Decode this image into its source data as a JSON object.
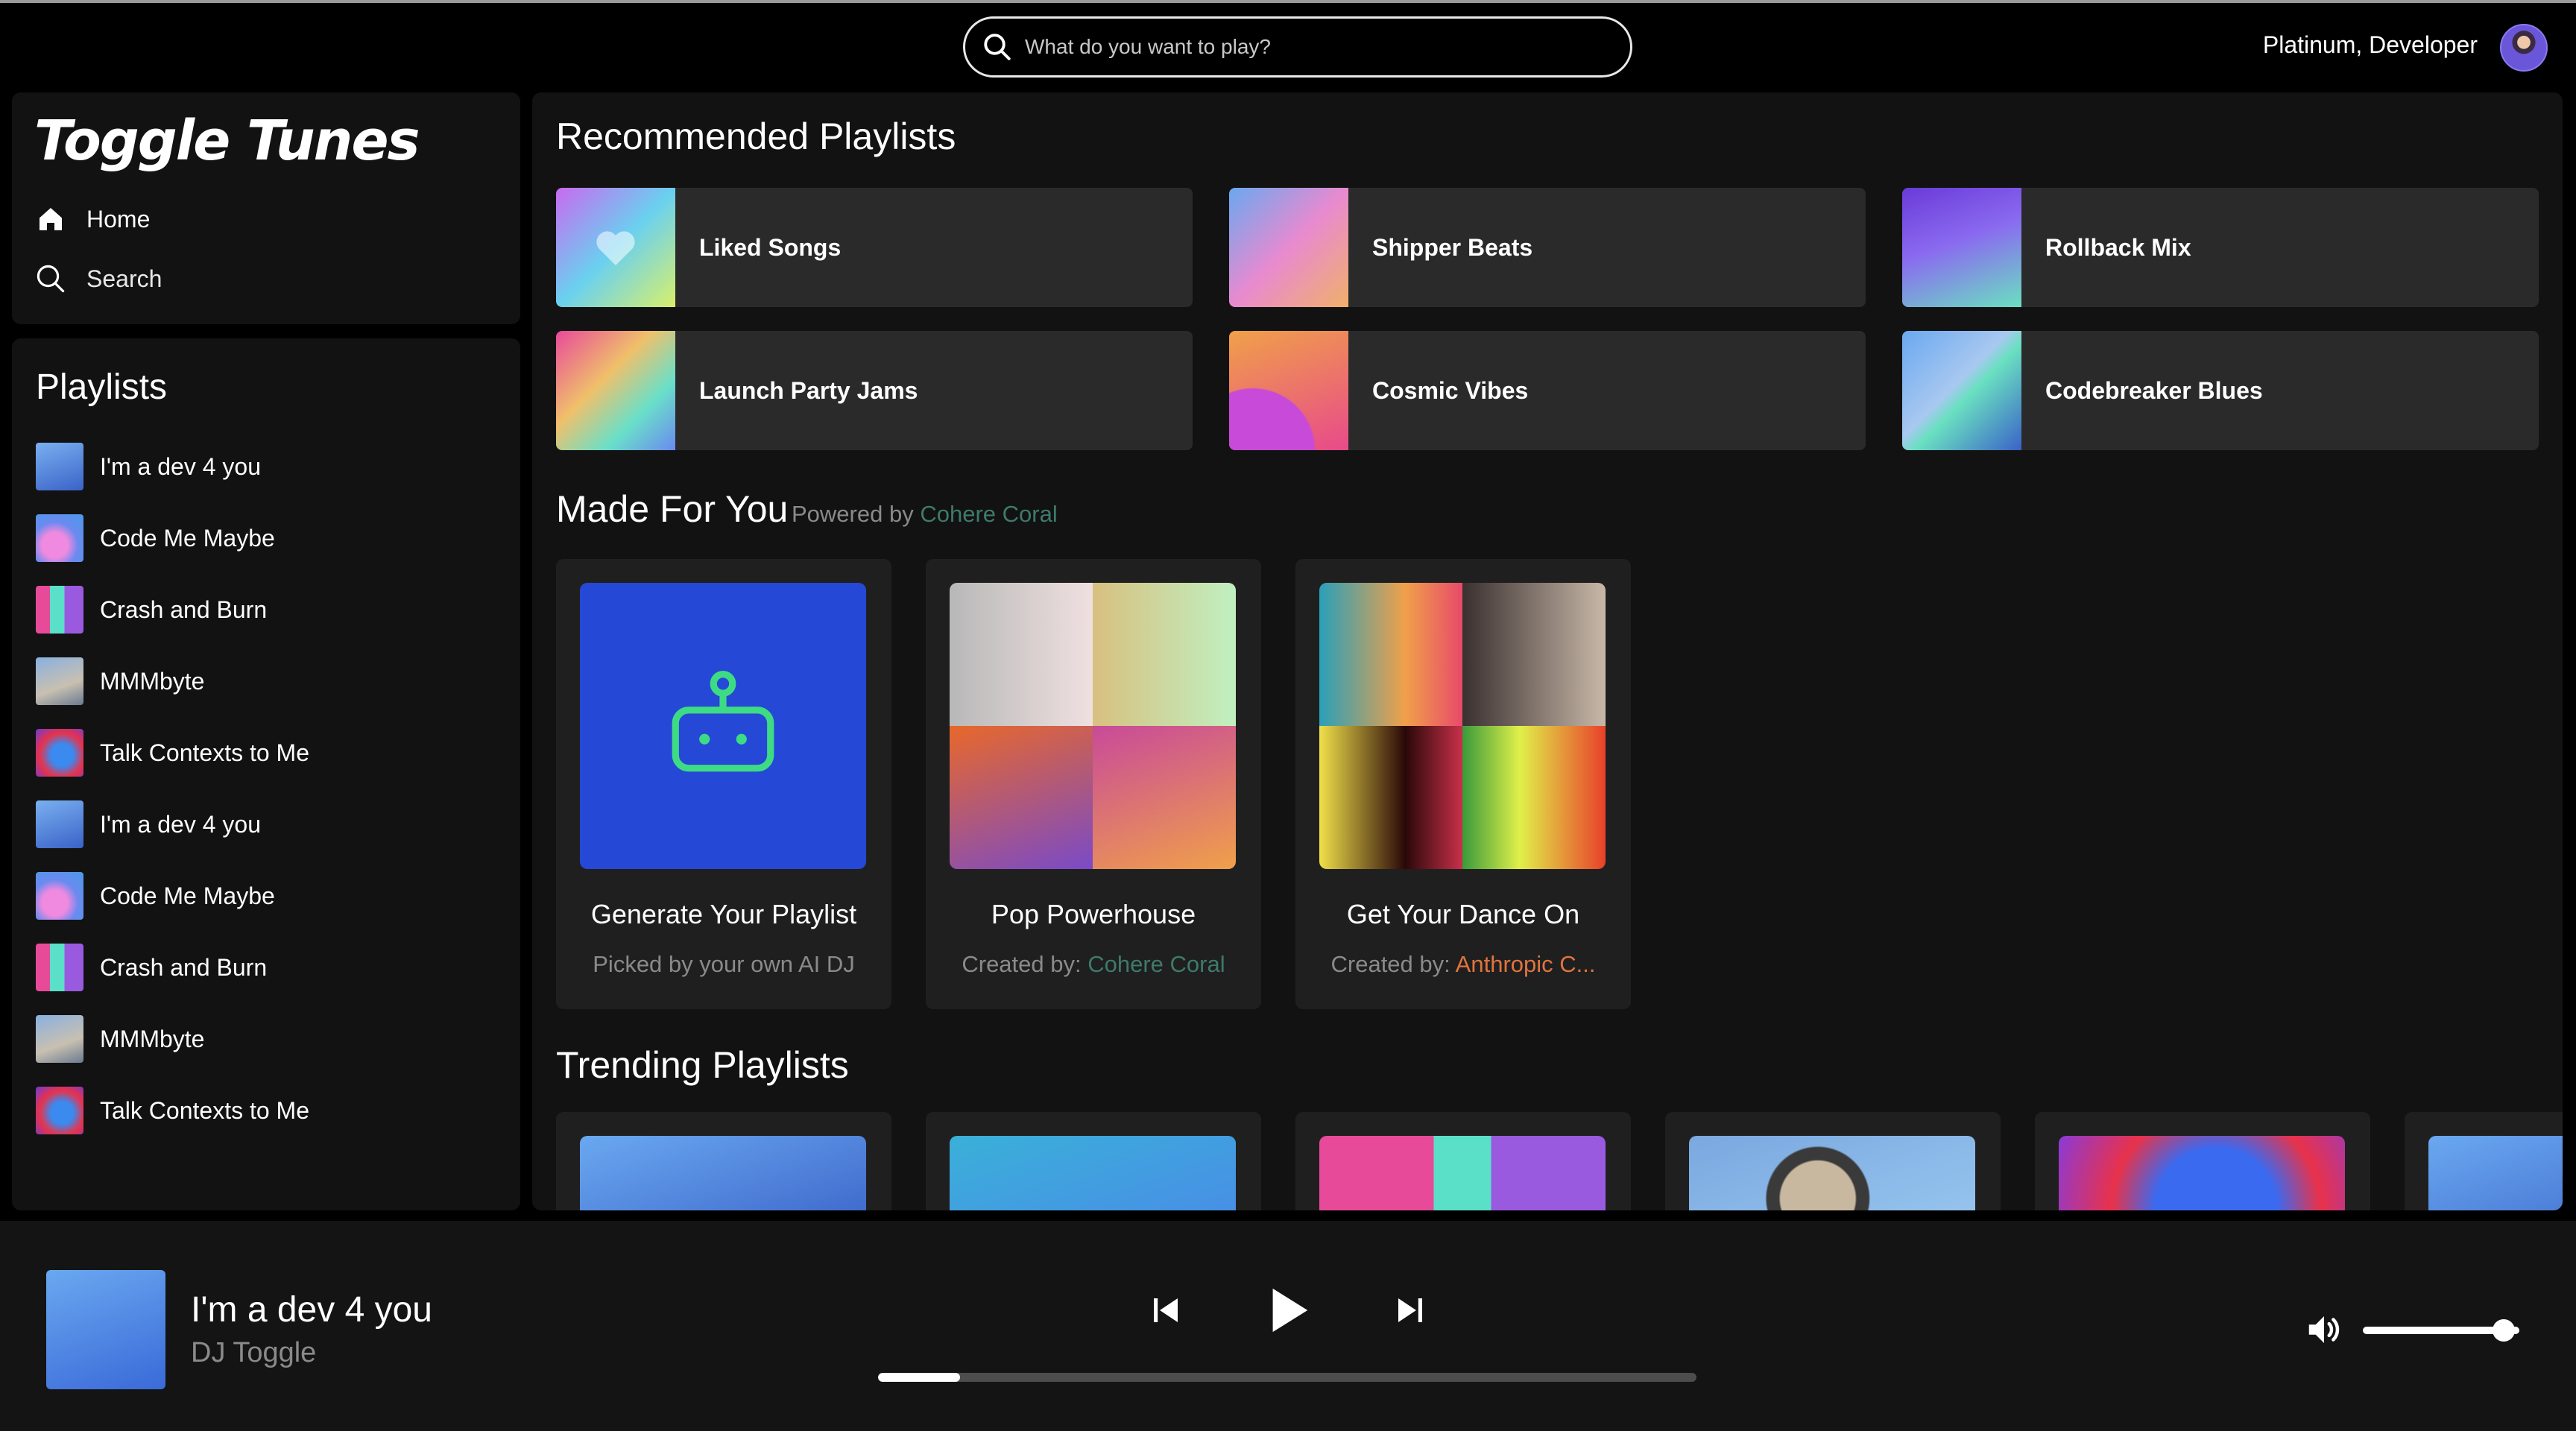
{
  "header": {
    "search_placeholder": "What do you want to play?",
    "user_name": "Platinum, Developer"
  },
  "nav": {
    "logo": "Toggle Tunes",
    "items": [
      {
        "label": "Home",
        "icon": "home-icon"
      },
      {
        "label": "Search",
        "icon": "search-icon"
      }
    ]
  },
  "library": {
    "title": "Playlists",
    "items": [
      {
        "label": "I'm a dev 4 you"
      },
      {
        "label": "Code Me Maybe"
      },
      {
        "label": "Crash and Burn"
      },
      {
        "label": "MMMbyte"
      },
      {
        "label": "Talk Contexts to Me"
      },
      {
        "label": "I'm a dev 4 you"
      },
      {
        "label": "Code Me Maybe"
      },
      {
        "label": "Crash and Burn"
      },
      {
        "label": "MMMbyte"
      },
      {
        "label": "Talk Contexts to Me"
      }
    ]
  },
  "recommended": {
    "title": "Recommended Playlists",
    "items": [
      {
        "label": "Liked Songs"
      },
      {
        "label": "Shipper Beats"
      },
      {
        "label": "Rollback Mix"
      },
      {
        "label": "Launch Party Jams"
      },
      {
        "label": "Cosmic Vibes"
      },
      {
        "label": "Codebreaker Blues"
      }
    ]
  },
  "made_for_you": {
    "title": "Made For You",
    "powered_prefix": "Powered by",
    "powered_brand": "Cohere Coral",
    "items": [
      {
        "title": "Generate Your Playlist",
        "subtitle": "Picked by your own AI DJ",
        "creator": ""
      },
      {
        "title": "Pop Powerhouse",
        "subtitle": "Created by:",
        "creator": "Cohere Coral"
      },
      {
        "title": "Get Your Dance On",
        "subtitle": "Created by:",
        "creator": "Anthropic C..."
      }
    ]
  },
  "trending": {
    "title": "Trending Playlists"
  },
  "player": {
    "title": "I'm a dev 4 you",
    "artist": "DJ Toggle",
    "progress": 0.1,
    "volume": 0.9
  },
  "colors": {
    "accent_robot": "#3ddc84",
    "robot_bg": "#2648d6",
    "coral_text": "#3e7a6a",
    "anthropic_text": "#e0743f"
  }
}
